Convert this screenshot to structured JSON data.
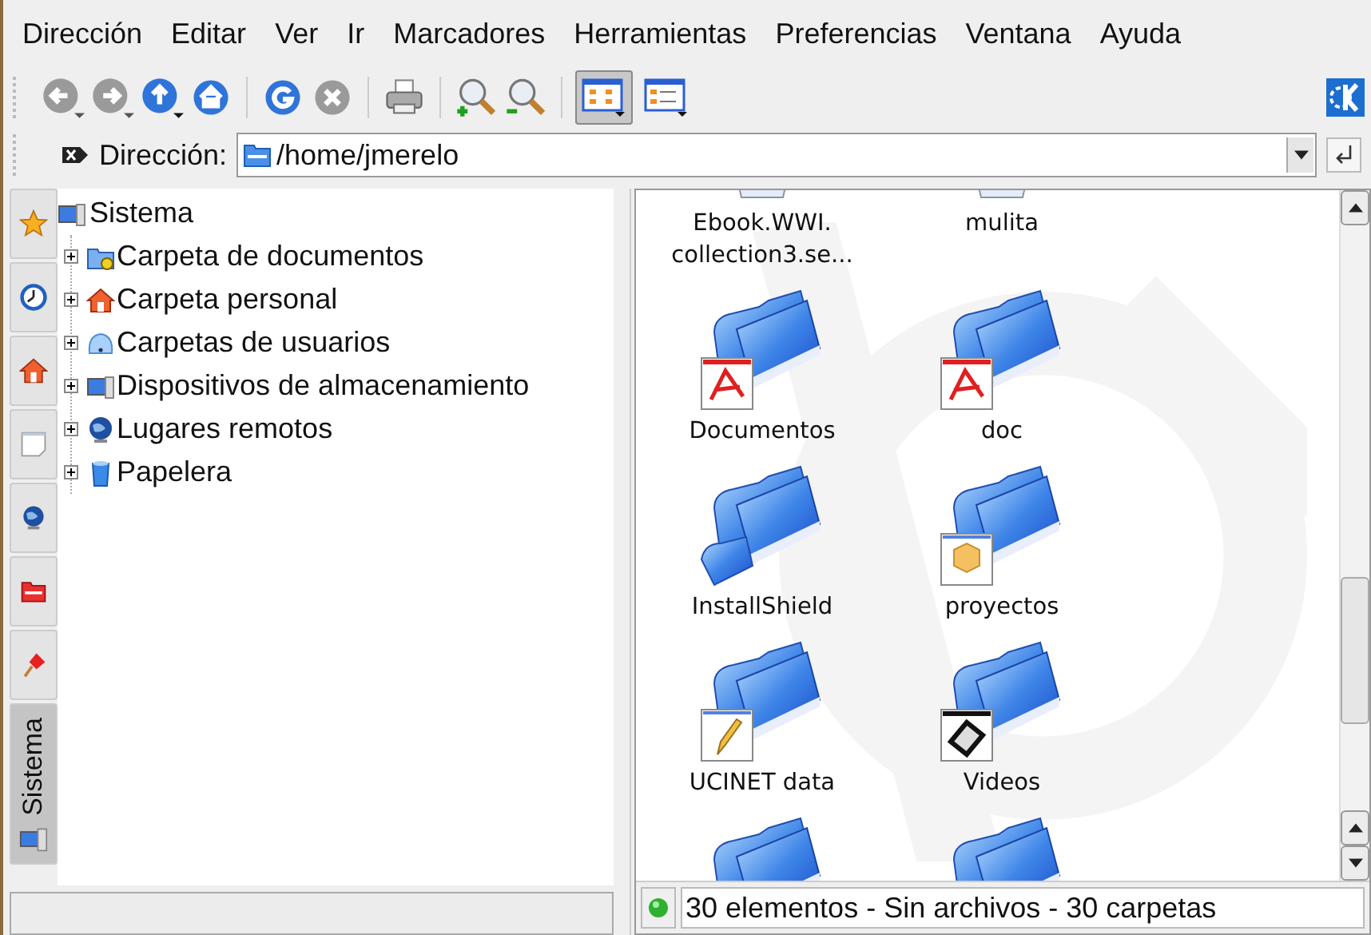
{
  "menu": [
    "Dirección",
    "Editar",
    "Ver",
    "Ir",
    "Marcadores",
    "Herramientas",
    "Preferencias",
    "Ventana",
    "Ayuda"
  ],
  "toolbar": {
    "view_modes": [
      {
        "selected": true
      },
      {
        "selected": false
      }
    ]
  },
  "location": {
    "label": "Dirección:",
    "value": "/home/jmerelo"
  },
  "sidebar": {
    "tabs": [
      {
        "kind": "star",
        "selected": false
      },
      {
        "kind": "clock",
        "selected": false
      },
      {
        "kind": "home",
        "selected": false
      },
      {
        "kind": "note",
        "selected": false
      },
      {
        "kind": "globe",
        "selected": false
      },
      {
        "kind": "folder",
        "selected": false
      },
      {
        "kind": "pin",
        "selected": false
      },
      {
        "kind": "system",
        "label": "Sistema",
        "selected": true
      }
    ]
  },
  "tree": {
    "label": "Sistema",
    "kind": "system",
    "children": [
      {
        "label": "Carpeta de documentos",
        "kind": "docs",
        "expanded": false
      },
      {
        "label": "Carpeta personal",
        "kind": "home",
        "expanded": false
      },
      {
        "label": "Carpetas de usuarios",
        "kind": "users",
        "expanded": false
      },
      {
        "label": "Dispositivos de almacenamiento",
        "kind": "system",
        "expanded": false
      },
      {
        "label": "Lugares remotos",
        "kind": "globe",
        "expanded": false
      },
      {
        "label": "Papelera",
        "kind": "trash",
        "expanded": false
      }
    ]
  },
  "files": [
    {
      "name": "Ebook.WWI. collection3.se...",
      "clipped": true
    },
    {
      "name": "mulita",
      "clipped": true
    },
    {
      "name": "Documentos",
      "kind": "pdf"
    },
    {
      "name": "doc",
      "kind": "pdf"
    },
    {
      "name": "InstallShield",
      "kind": "subfolder"
    },
    {
      "name": "proyectos",
      "kind": "package"
    },
    {
      "name": "UCINET data",
      "kind": "text"
    },
    {
      "name": "Videos",
      "kind": "video"
    },
    {
      "kind": "folder"
    },
    {
      "kind": "folder"
    }
  ],
  "status_bar": "30 elementos - Sin archivos - 30 carpetas"
}
